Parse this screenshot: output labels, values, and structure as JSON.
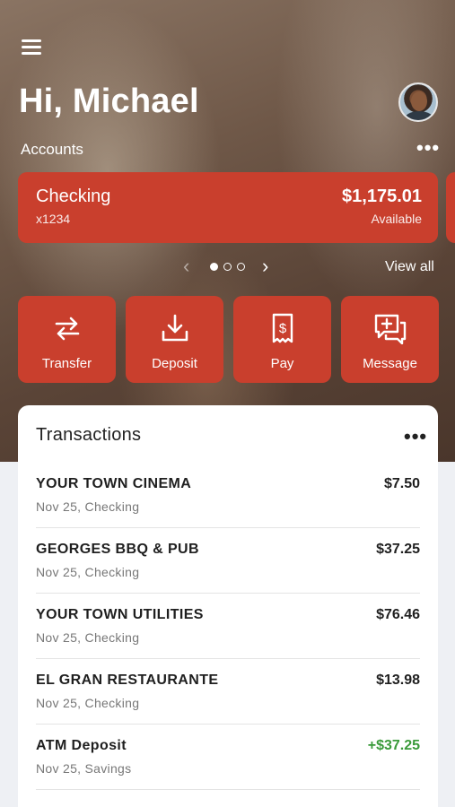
{
  "header": {
    "greeting": "Hi, Michael"
  },
  "accounts": {
    "label": "Accounts",
    "more": "•••",
    "card": {
      "name": "Checking",
      "number": "x1234",
      "balance": "$1,175.01",
      "balance_label": "Available"
    },
    "pager": {
      "prev": "‹",
      "next": "›",
      "page_count": 3,
      "current_page": 1
    },
    "view_all": "View all"
  },
  "actions": [
    {
      "label": "Transfer",
      "icon": "transfer-icon"
    },
    {
      "label": "Deposit",
      "icon": "deposit-icon"
    },
    {
      "label": "Pay",
      "icon": "pay-receipt-icon"
    },
    {
      "label": "Message",
      "icon": "message-icon"
    }
  ],
  "transactions": {
    "title": "Transactions",
    "more": "•••",
    "items": [
      {
        "name": "YOUR TOWN CINEMA",
        "sub": "Nov 25, Checking",
        "amount": "$7.50",
        "positive": false
      },
      {
        "name": "GEORGES BBQ & PUB",
        "sub": "Nov 25, Checking",
        "amount": "$37.25",
        "positive": false
      },
      {
        "name": "YOUR TOWN UTILITIES",
        "sub": "Nov 25, Checking",
        "amount": "$76.46",
        "positive": false
      },
      {
        "name": "EL GRAN RESTAURANTE",
        "sub": "Nov 25, Checking",
        "amount": "$13.98",
        "positive": false
      },
      {
        "name": "ATM Deposit",
        "sub": "Nov 25, Savings",
        "amount": "+$37.25",
        "positive": true
      }
    ]
  },
  "colors": {
    "accent": "#c93f2d",
    "positive": "#3a9a3a"
  }
}
